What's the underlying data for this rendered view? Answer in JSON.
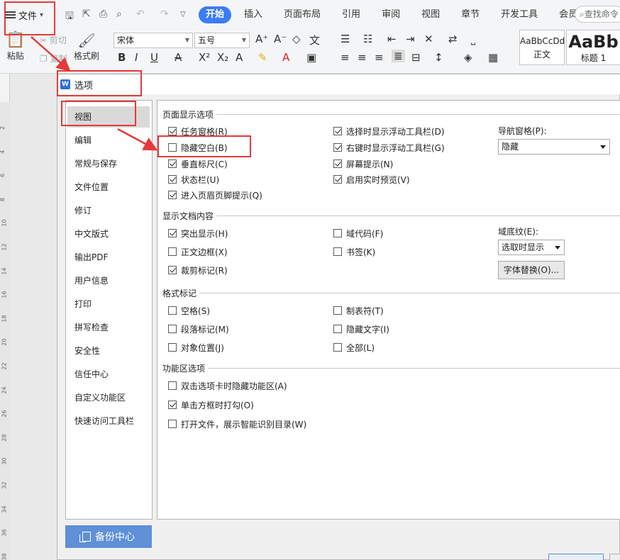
{
  "ribbon": {
    "file_menu": "文件",
    "tabs": [
      {
        "label": "开始",
        "active": true
      },
      {
        "label": "插入",
        "active": false
      },
      {
        "label": "页面布局",
        "active": false
      },
      {
        "label": "引用",
        "active": false
      },
      {
        "label": "审阅",
        "active": false
      },
      {
        "label": "视图",
        "active": false
      },
      {
        "label": "章节",
        "active": false
      },
      {
        "label": "开发工具",
        "active": false
      },
      {
        "label": "会员专享",
        "active": false
      }
    ],
    "search_placeholder": "查找命令",
    "paste_label": "粘贴",
    "cut_label": "剪切",
    "copy_label": "复制",
    "format_painter_label": "格式刷",
    "font_name": "宋体",
    "font_size": "五号",
    "styles": [
      {
        "sample": "AaBbCcDd",
        "name": "正文"
      },
      {
        "sample": "AaBb",
        "name": "标题 1"
      }
    ]
  },
  "ruler_numbers": [
    "2",
    "4",
    "6",
    "8",
    "10",
    "12",
    "14",
    "16",
    "18",
    "20",
    "22",
    "24",
    "26",
    "28",
    "30",
    "32",
    "34",
    "36",
    "38"
  ],
  "dialog": {
    "title": "选项",
    "nav_items": [
      {
        "label": "视图",
        "selected": true
      },
      {
        "label": "编辑",
        "selected": false
      },
      {
        "label": "常规与保存",
        "selected": false
      },
      {
        "label": "文件位置",
        "selected": false
      },
      {
        "label": "修订",
        "selected": false
      },
      {
        "label": "中文版式",
        "selected": false
      },
      {
        "label": "输出PDF",
        "selected": false
      },
      {
        "label": "用户信息",
        "selected": false
      },
      {
        "label": "打印",
        "selected": false
      },
      {
        "label": "拼写检查",
        "selected": false
      },
      {
        "label": "安全性",
        "selected": false
      },
      {
        "label": "信任中心",
        "selected": false
      },
      {
        "label": "自定义功能区",
        "selected": false
      },
      {
        "label": "快速访问工具栏",
        "selected": false
      }
    ],
    "backup_button": "备份中心",
    "groups": {
      "page_display": {
        "title": "页面显示选项",
        "options": [
          {
            "label": "任务窗格(R)",
            "checked": true
          },
          {
            "label": "隐藏空白(B)",
            "checked": false
          },
          {
            "label": "垂直标尺(C)",
            "checked": true
          },
          {
            "label": "状态栏(U)",
            "checked": true
          },
          {
            "label": "进入页眉页脚提示(Q)",
            "checked": true
          },
          {
            "label": "选择时显示浮动工具栏(D)",
            "checked": true
          },
          {
            "label": "右键时显示浮动工具栏(G)",
            "checked": true
          },
          {
            "label": "屏幕提示(N)",
            "checked": true
          },
          {
            "label": "启用实时预览(V)",
            "checked": true
          }
        ],
        "nav_pane_label": "导航窗格(P):",
        "nav_pane_value": "隐藏"
      },
      "doc_content": {
        "title": "显示文档内容",
        "options": [
          {
            "label": "突出显示(H)",
            "checked": true
          },
          {
            "label": "正文边框(X)",
            "checked": false
          },
          {
            "label": "裁剪标记(R)",
            "checked": true
          },
          {
            "label": "域代码(F)",
            "checked": false
          },
          {
            "label": "书签(K)",
            "checked": false
          }
        ],
        "shading_label": "域底纹(E):",
        "shading_value": "选取时显示",
        "font_sub_button": "字体替换(O)..."
      },
      "format_marks": {
        "title": "格式标记",
        "options": [
          {
            "label": "空格(S)",
            "checked": false
          },
          {
            "label": "段落标记(M)",
            "checked": false
          },
          {
            "label": "对象位置(J)",
            "checked": false
          },
          {
            "label": "制表符(T)",
            "checked": false
          },
          {
            "label": "隐藏文字(I)",
            "checked": false
          },
          {
            "label": "全部(L)",
            "checked": false
          }
        ]
      },
      "ribbon_options": {
        "title": "功能区选项",
        "options": [
          {
            "label": "双击选项卡时隐藏功能区(A)",
            "checked": false
          },
          {
            "label": "单击方框时打勾(O)",
            "checked": true
          },
          {
            "label": "打开文件，展示智能识别目录(W)",
            "checked": false
          }
        ]
      }
    }
  },
  "colors": {
    "accent": "#3b7cf3",
    "annotation": "#e43a3a",
    "backup_button": "#5f90d8"
  }
}
